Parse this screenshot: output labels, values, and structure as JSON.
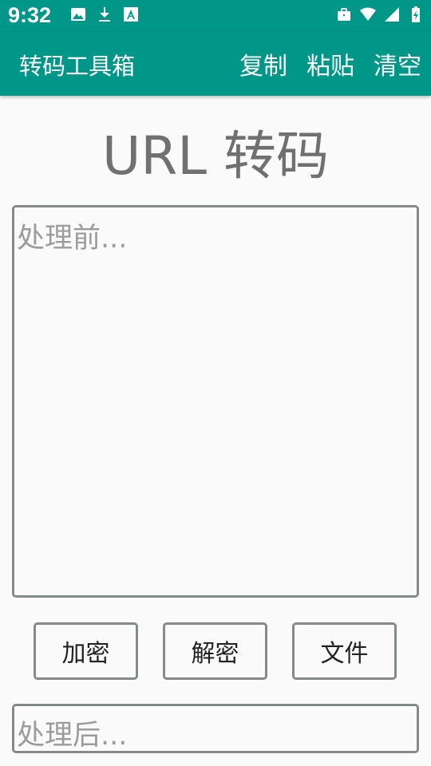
{
  "status_bar": {
    "time": "9:32",
    "left_icons": [
      "image-icon",
      "download-icon",
      "text-a-icon"
    ],
    "right_icons": [
      "briefcase-icon",
      "wifi-icon",
      "cell-signal-icon",
      "battery-charging-icon"
    ]
  },
  "app_bar": {
    "title": "转码工具箱",
    "actions": {
      "copy": "复制",
      "paste": "粘贴",
      "clear": "清空"
    }
  },
  "page": {
    "title": "URL 转码",
    "input": {
      "placeholder": "处理前...",
      "value": ""
    },
    "output": {
      "placeholder": "处理后...",
      "value": ""
    },
    "buttons": {
      "encrypt": "加密",
      "decrypt": "解密",
      "file": "文件"
    }
  },
  "colors": {
    "primary": "#009688",
    "border": "#848a88",
    "background": "#fafafa",
    "title_text": "#707070",
    "placeholder_text": "#9c9c9c"
  }
}
